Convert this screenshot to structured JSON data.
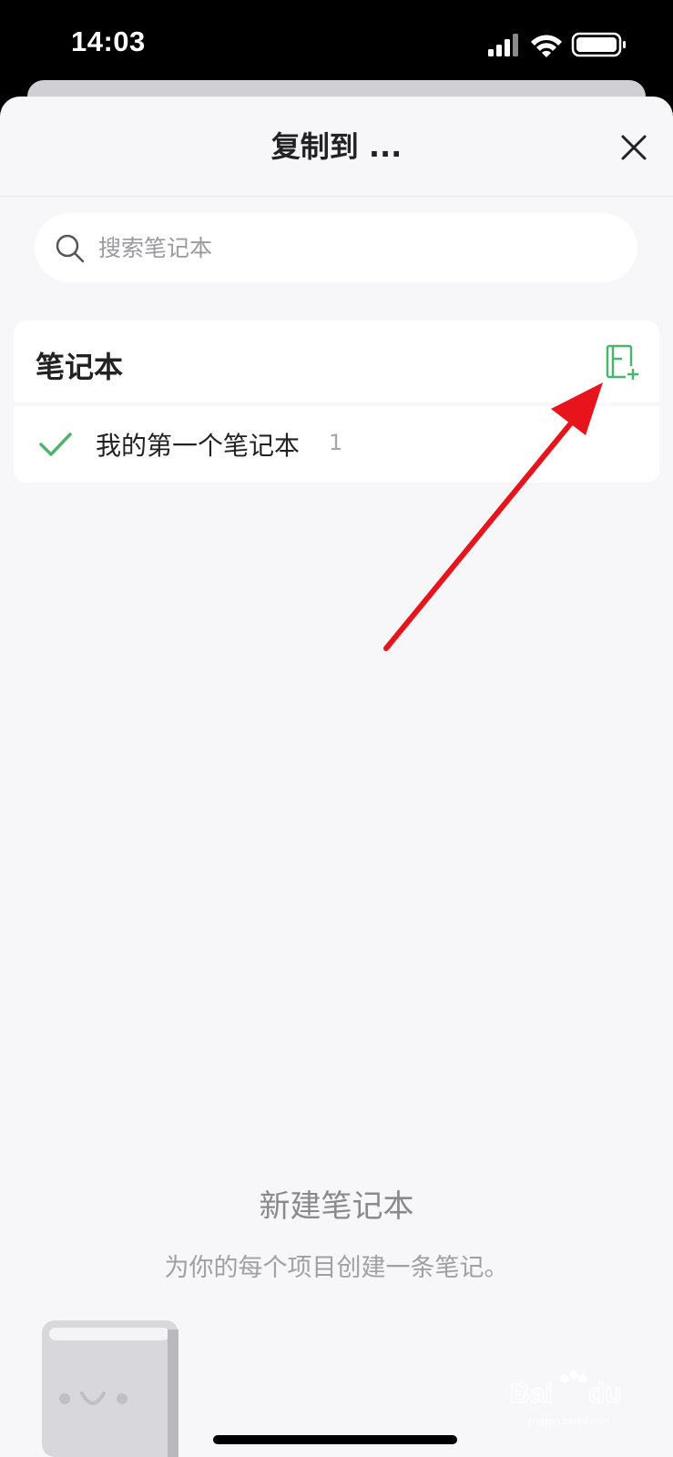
{
  "status_bar": {
    "time": "14:03"
  },
  "sheet": {
    "title": "复制到 ...",
    "close_icon": "close-icon"
  },
  "search": {
    "placeholder": "搜索笔记本",
    "value": "",
    "icon": "search-icon"
  },
  "notebooks": {
    "section_title": "笔记本",
    "add_icon": "add-notebook-icon",
    "items": [
      {
        "label": "我的第一个笔记本",
        "count": "1",
        "selected": true
      }
    ]
  },
  "empty_state": {
    "title": "新建笔记本",
    "subtitle": "为你的每个项目创建一条笔记。"
  },
  "watermark": {
    "text": "Baidu经验",
    "subtext": "jingyan.baidu.com"
  },
  "colors": {
    "accent_green": "#4cb56d",
    "annotation_red": "#e8141b",
    "sheet_bg": "#f7f7fa"
  }
}
